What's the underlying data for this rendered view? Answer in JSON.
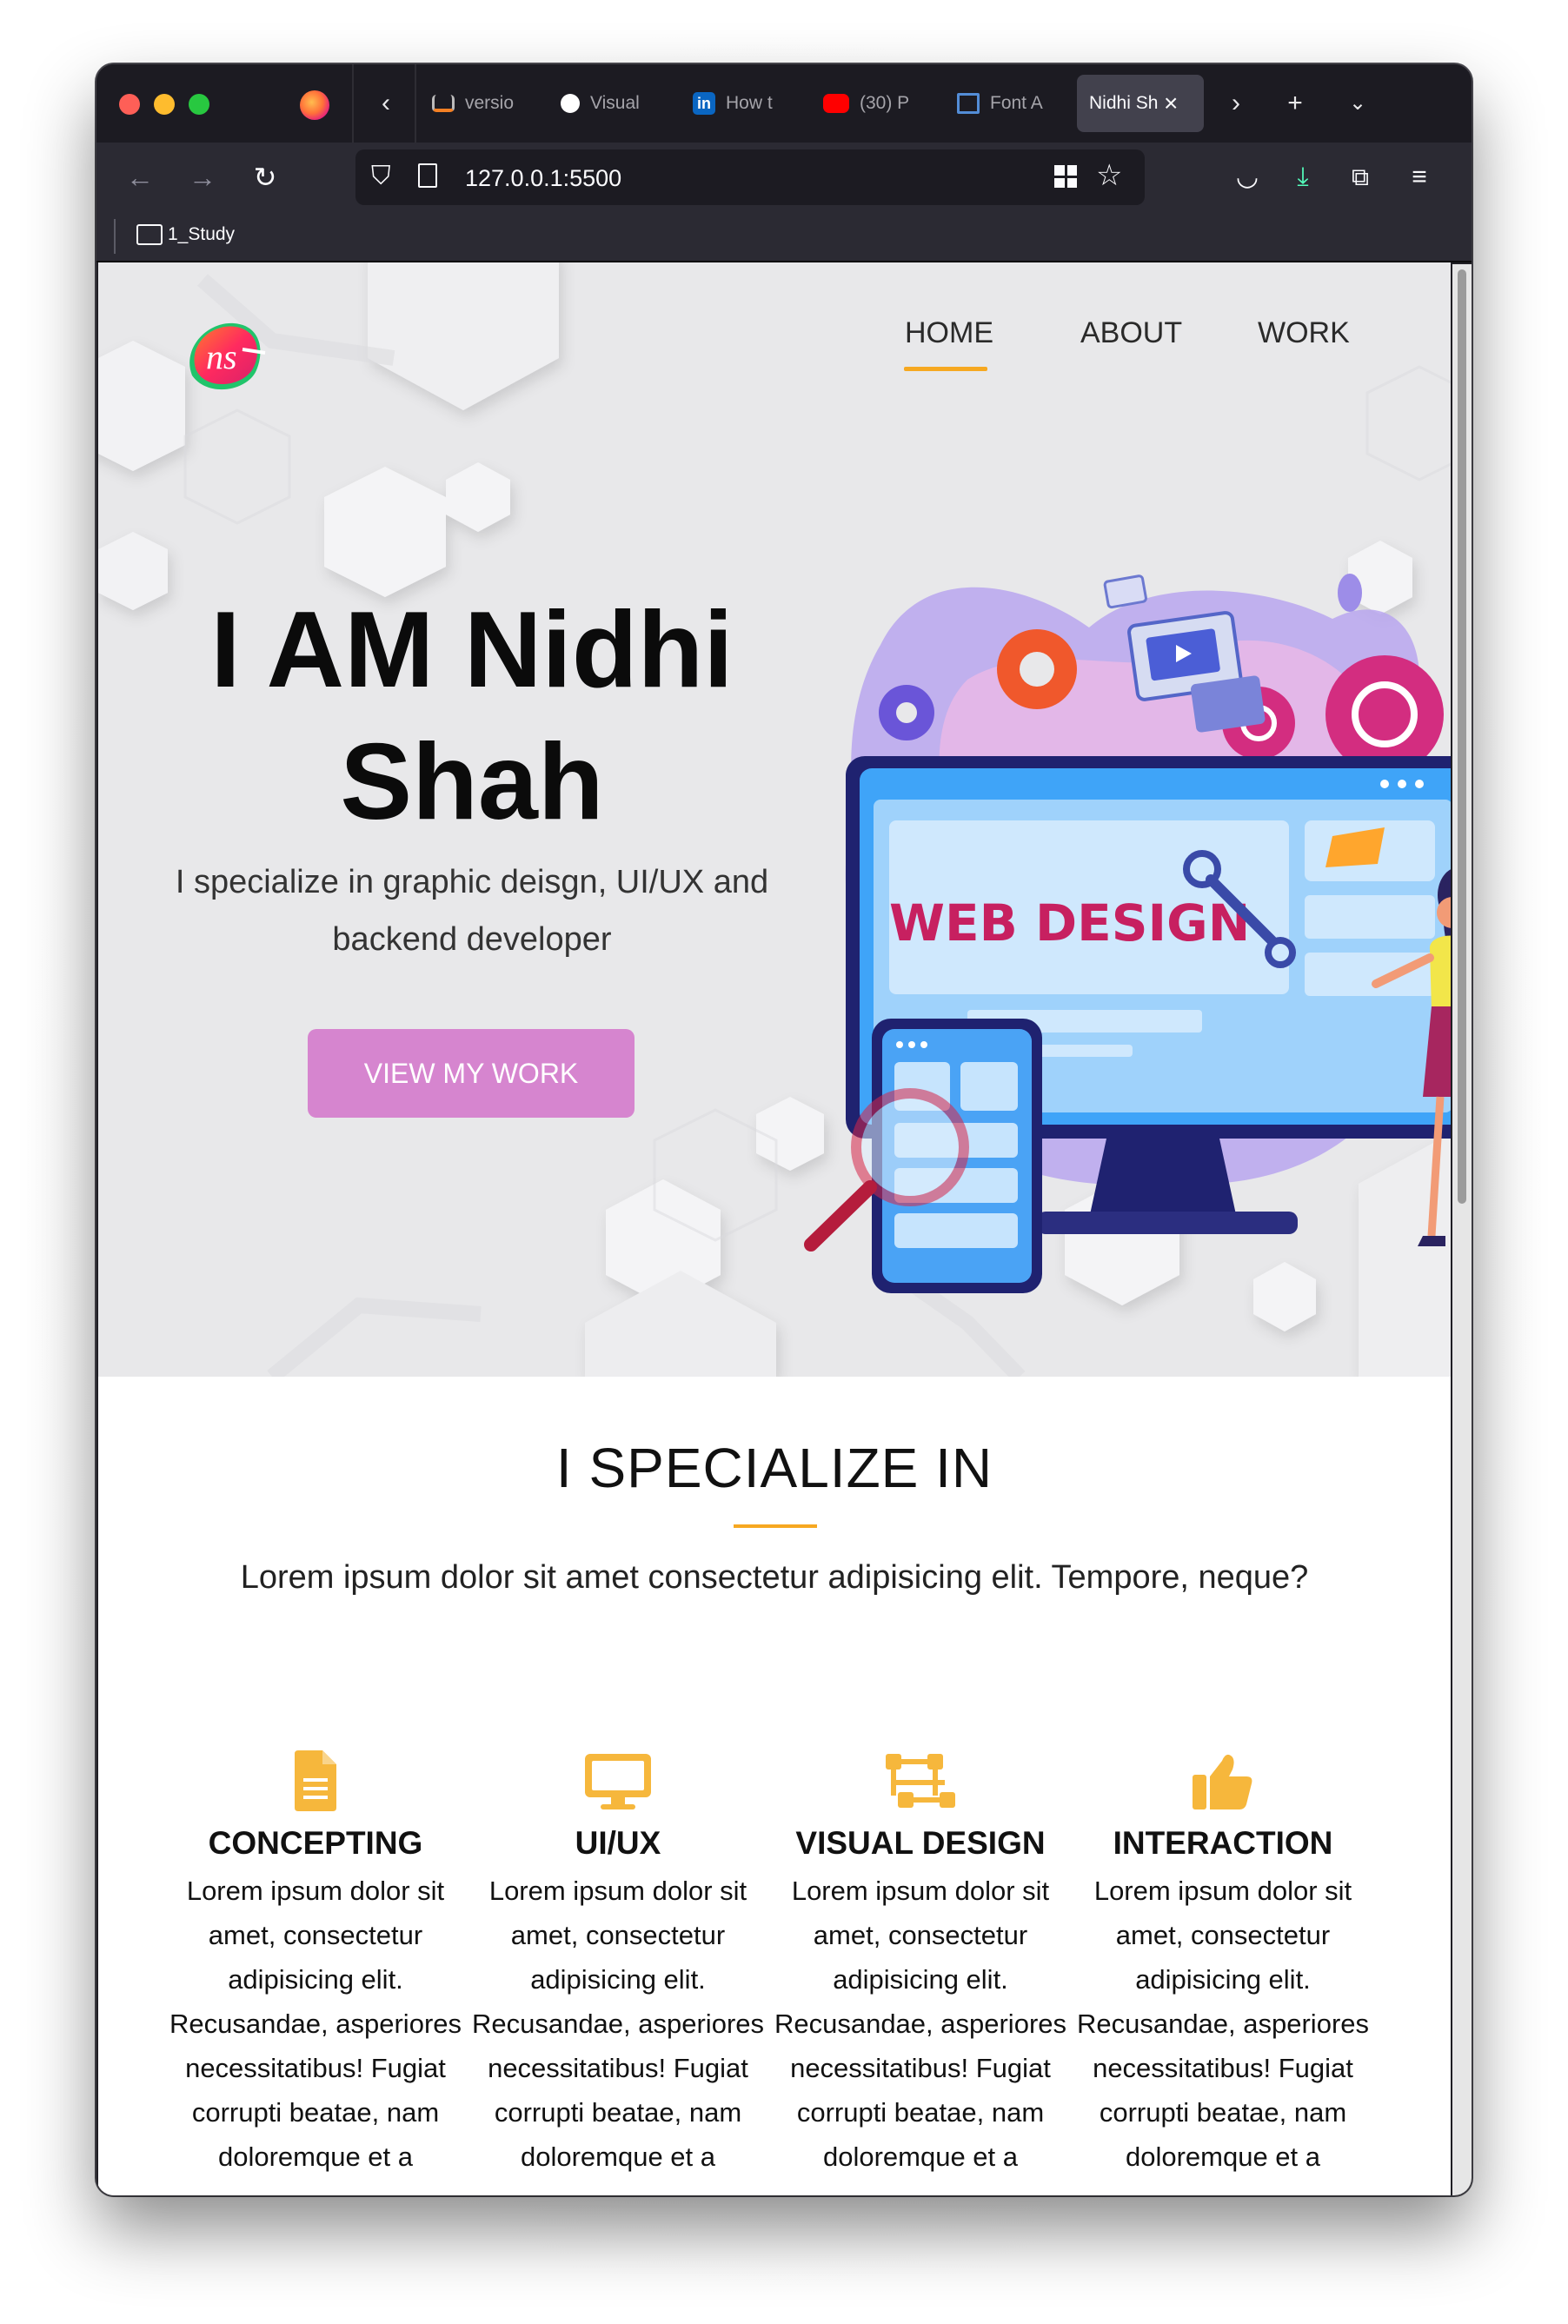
{
  "browser": {
    "tabs": [
      {
        "title": "versio",
        "icon": "stackoverflow-icon"
      },
      {
        "title": "Visual",
        "icon": "medium-icon"
      },
      {
        "title": "How t",
        "icon": "linkedin-icon"
      },
      {
        "title": "(30) P",
        "icon": "youtube-icon"
      },
      {
        "title": "Font A",
        "icon": "fontawesome-flag-icon"
      },
      {
        "title": "Nidhi Sh",
        "icon": ""
      }
    ],
    "url": "127.0.0.1:5500",
    "bookmark": "1_Study"
  },
  "site": {
    "logo_text": "ns",
    "nav": [
      "HOME",
      "ABOUT",
      "WORK"
    ],
    "active_nav": "HOME",
    "headline_line1": "I AM Nidhi",
    "headline_line2": "Shah",
    "subline": "I specialize in graphic deisgn, UI/UX and backend developer",
    "cta": "VIEW MY WORK",
    "illustration_text": "WEB DESIGN",
    "accent_color": "#f6a821",
    "cta_color": "#d685cf"
  },
  "specialize": {
    "title": "I SPECIALIZE IN",
    "description": "Lorem ipsum dolor sit amet consectetur adipisicing elit. Tempore, neque?",
    "items": [
      {
        "icon": "document-icon",
        "title": "CONCEPTING",
        "text": "Lorem ipsum dolor sit amet, consectetur adipisicing elit. Recusandae, asperiores necessitatibus! Fugiat corrupti beatae, nam doloremque et a"
      },
      {
        "icon": "desktop-icon",
        "title": "UI/UX",
        "text": "Lorem ipsum dolor sit amet, consectetur adipisicing elit. Recusandae, asperiores necessitatibus! Fugiat corrupti beatae, nam doloremque et a"
      },
      {
        "icon": "vector-square-icon",
        "title": "VISUAL DESIGN",
        "text": "Lorem ipsum dolor sit amet, consectetur adipisicing elit. Recusandae, asperiores necessitatibus! Fugiat corrupti beatae, nam doloremque et a"
      },
      {
        "icon": "thumbs-up-icon",
        "title": "INTERACTION",
        "text": "Lorem ipsum dolor sit amet, consectetur adipisicing elit. Recusandae, asperiores necessitatibus! Fugiat corrupti beatae, nam doloremque et a"
      }
    ]
  }
}
